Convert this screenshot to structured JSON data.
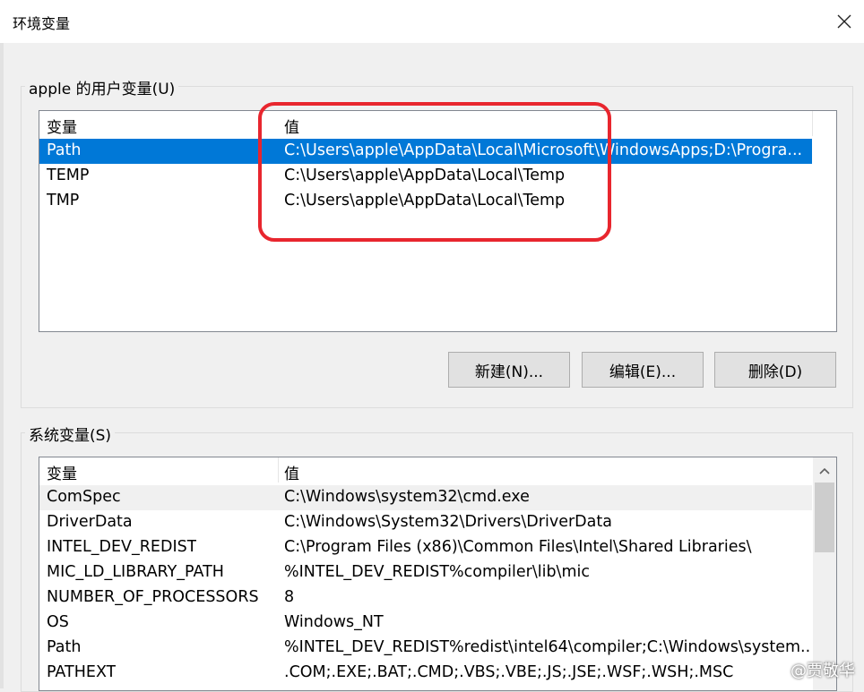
{
  "window": {
    "title": "环境变量"
  },
  "user_vars": {
    "group_label": "apple 的用户变量(U)",
    "columns": [
      "变量",
      "值"
    ],
    "rows": [
      {
        "name": "Path",
        "value": "C:\\Users\\apple\\AppData\\Local\\Microsoft\\WindowsApps;D:\\Progra...",
        "selected": true
      },
      {
        "name": "TEMP",
        "value": "C:\\Users\\apple\\AppData\\Local\\Temp"
      },
      {
        "name": "TMP",
        "value": "C:\\Users\\apple\\AppData\\Local\\Temp"
      }
    ],
    "buttons": {
      "new": "新建(N)...",
      "edit": "编辑(E)...",
      "delete": "删除(D)"
    }
  },
  "system_vars": {
    "group_label": "系统变量(S)",
    "columns": [
      "变量",
      "值"
    ],
    "rows": [
      {
        "name": "ComSpec",
        "value": "C:\\Windows\\system32\\cmd.exe"
      },
      {
        "name": "DriverData",
        "value": "C:\\Windows\\System32\\Drivers\\DriverData"
      },
      {
        "name": "INTEL_DEV_REDIST",
        "value": "C:\\Program Files (x86)\\Common Files\\Intel\\Shared Libraries\\"
      },
      {
        "name": "MIC_LD_LIBRARY_PATH",
        "value": "%INTEL_DEV_REDIST%compiler\\lib\\mic"
      },
      {
        "name": "NUMBER_OF_PROCESSORS",
        "value": "8"
      },
      {
        "name": "OS",
        "value": "Windows_NT"
      },
      {
        "name": "Path",
        "value": "%INTEL_DEV_REDIST%redist\\intel64\\compiler;C:\\Windows\\system..."
      },
      {
        "name": "PATHEXT",
        "value": ".COM;.EXE;.BAT;.CMD;.VBS;.VBE;.JS;.JSE;.WSF;.WSH;.MSC"
      }
    ]
  },
  "watermark": "@贾敬华",
  "colors": {
    "selection": "#0078d7",
    "annotation": "#e8262e",
    "button_face": "#e1e1e1"
  },
  "icons": {
    "close": "close-icon",
    "scroll_up": "chevron-up-icon"
  }
}
